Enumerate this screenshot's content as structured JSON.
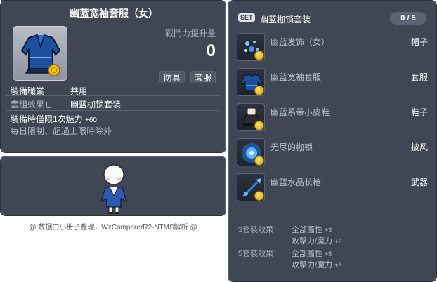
{
  "item_id": "01053379",
  "item": {
    "title": "幽蓝宽袖套服（女）",
    "combat_power_label": "戰鬥力提升量",
    "combat_power_value": "0",
    "tags": [
      "防具",
      "套服"
    ],
    "job_label": "裝備職業",
    "job_value": "共用",
    "set_label": "套組效果",
    "set_value": "幽蓝枷锁套装",
    "limit_text": "裝備時僅限1次魅力",
    "limit_value": "+60",
    "limit_note": "每日限制、超過上限時除外"
  },
  "footer": "@ 数据由小册子整理，WzComparerR2-NTMS解析 @",
  "set": {
    "badge": "SET",
    "name": "幽蓝枷锁套装",
    "count": "0 / 5",
    "items": [
      {
        "name": "幽蓝发饰（女）",
        "type": "帽子",
        "icon": "hair-accessory-icon"
      },
      {
        "name": "幽蓝宽袖套服",
        "type": "套服",
        "icon": "outfit-icon"
      },
      {
        "name": "幽蓝系带小皮鞋",
        "type": "鞋子",
        "icon": "shoes-icon"
      },
      {
        "name": "无尽的枷锁",
        "type": "披风",
        "icon": "cape-icon"
      },
      {
        "name": "幽蓝水晶长枪",
        "type": "武器",
        "icon": "spear-icon"
      }
    ],
    "bonuses": [
      {
        "label": "3套裝效果",
        "stats": [
          {
            "text": "全部屬性",
            "value": "+3"
          },
          {
            "text": "攻擊力/魔力",
            "value": "+2"
          }
        ]
      },
      {
        "label": "5套裝效果",
        "stats": [
          {
            "text": "全部屬性",
            "value": "+5"
          },
          {
            "text": "攻擊力/魔力",
            "value": "+3"
          }
        ]
      }
    ]
  }
}
